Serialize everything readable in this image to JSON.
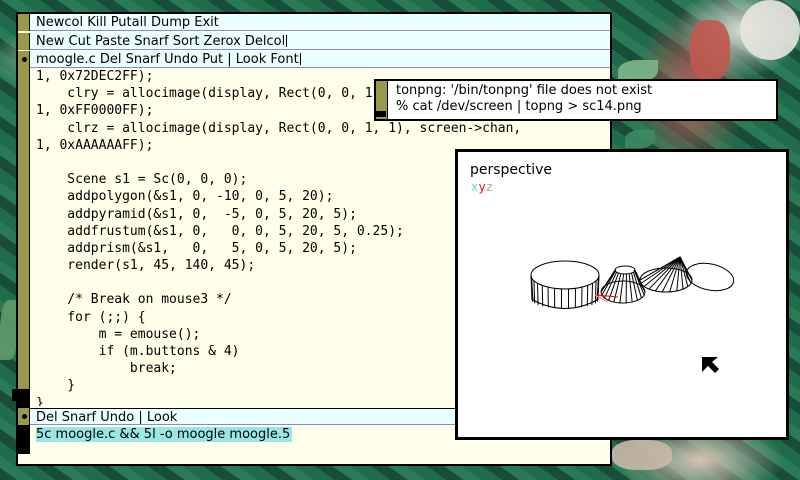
{
  "column": {
    "tag": "Newcol Kill Putall Dump Exit",
    "window_tag": "New Cut Paste Snarf Sort Zerox Delcol",
    "file_tag": "moogle.c Del Snarf Undo Put | Look Font",
    "body_lines": [
      "1, 0x72DEC2FF);",
      "    clry = allocimage(display, Rect(0, 0, 1, 1), screen->chan,",
      "1, 0xFF0000FF);",
      "    clrz = allocimage(display, Rect(0, 0, 1, 1), screen->chan,",
      "1, 0xAAAAAAFF);",
      "",
      "    Scene s1 = Sc(0, 0, 0);",
      "    addpolygon(&s1, 0, -10, 0, 5, 20);",
      "    addpyramid(&s1, 0,  -5, 0, 5, 20, 5);",
      "    addfrustum(&s1, 0,   0, 0, 5, 20, 5, 0.25);",
      "    addprism(&s1,   0,   5, 0, 5, 20, 5);",
      "    render(s1, 45, 140, 45);",
      "",
      "    /* Break on mouse3 */",
      "    for (;;) {",
      "        m = emouse();",
      "        if (m.buttons & 4)",
      "            break;",
      "    }",
      "}"
    ],
    "bottom_tag": "Del Snarf Undo | Look",
    "command": "5c moogle.c && 5l -o moogle moogle.5"
  },
  "tonpng": {
    "line1": "tonpng: '/bin/tonpng' file does not exist",
    "line2": "% cat /dev/screen | topng > sc14.png"
  },
  "perspective": {
    "title": "perspective",
    "axis_x": "x",
    "axis_y": "y",
    "axis_z": "z",
    "colors": {
      "x": "#72DEC2",
      "y": "#FF0000",
      "z": "#AAAAAA"
    }
  },
  "icons": [
    "arrow-cursor-icon"
  ],
  "colors": {
    "tag_bg": "#eaffff",
    "body_bg": "#ffffea",
    "gutter": "#99994c",
    "selection": "#99e6e6"
  }
}
